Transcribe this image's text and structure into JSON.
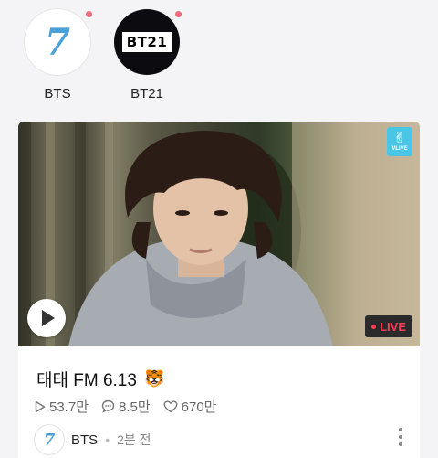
{
  "channels": [
    {
      "name": "BTS",
      "avatar_text": "7",
      "has_new": true
    },
    {
      "name": "BT21",
      "avatar_text": "BT21",
      "has_new": true
    }
  ],
  "video": {
    "badge_top": {
      "text": "VLIVE",
      "icon": "v-hand-icon",
      "color": "#49c6e5"
    },
    "live_label": "LIVE",
    "title": "태태 FM 6.13",
    "title_emoji": "🐯",
    "stats": {
      "plays": "53.7만",
      "comments": "8.5만",
      "likes": "670만"
    },
    "channel": {
      "name": "BTS",
      "avatar_text": "7"
    },
    "time_ago": "2분 전"
  },
  "colors": {
    "accent_live": "#ff3d57",
    "vlive_blue": "#49c6e5",
    "new_dot": "#f06b7b"
  }
}
